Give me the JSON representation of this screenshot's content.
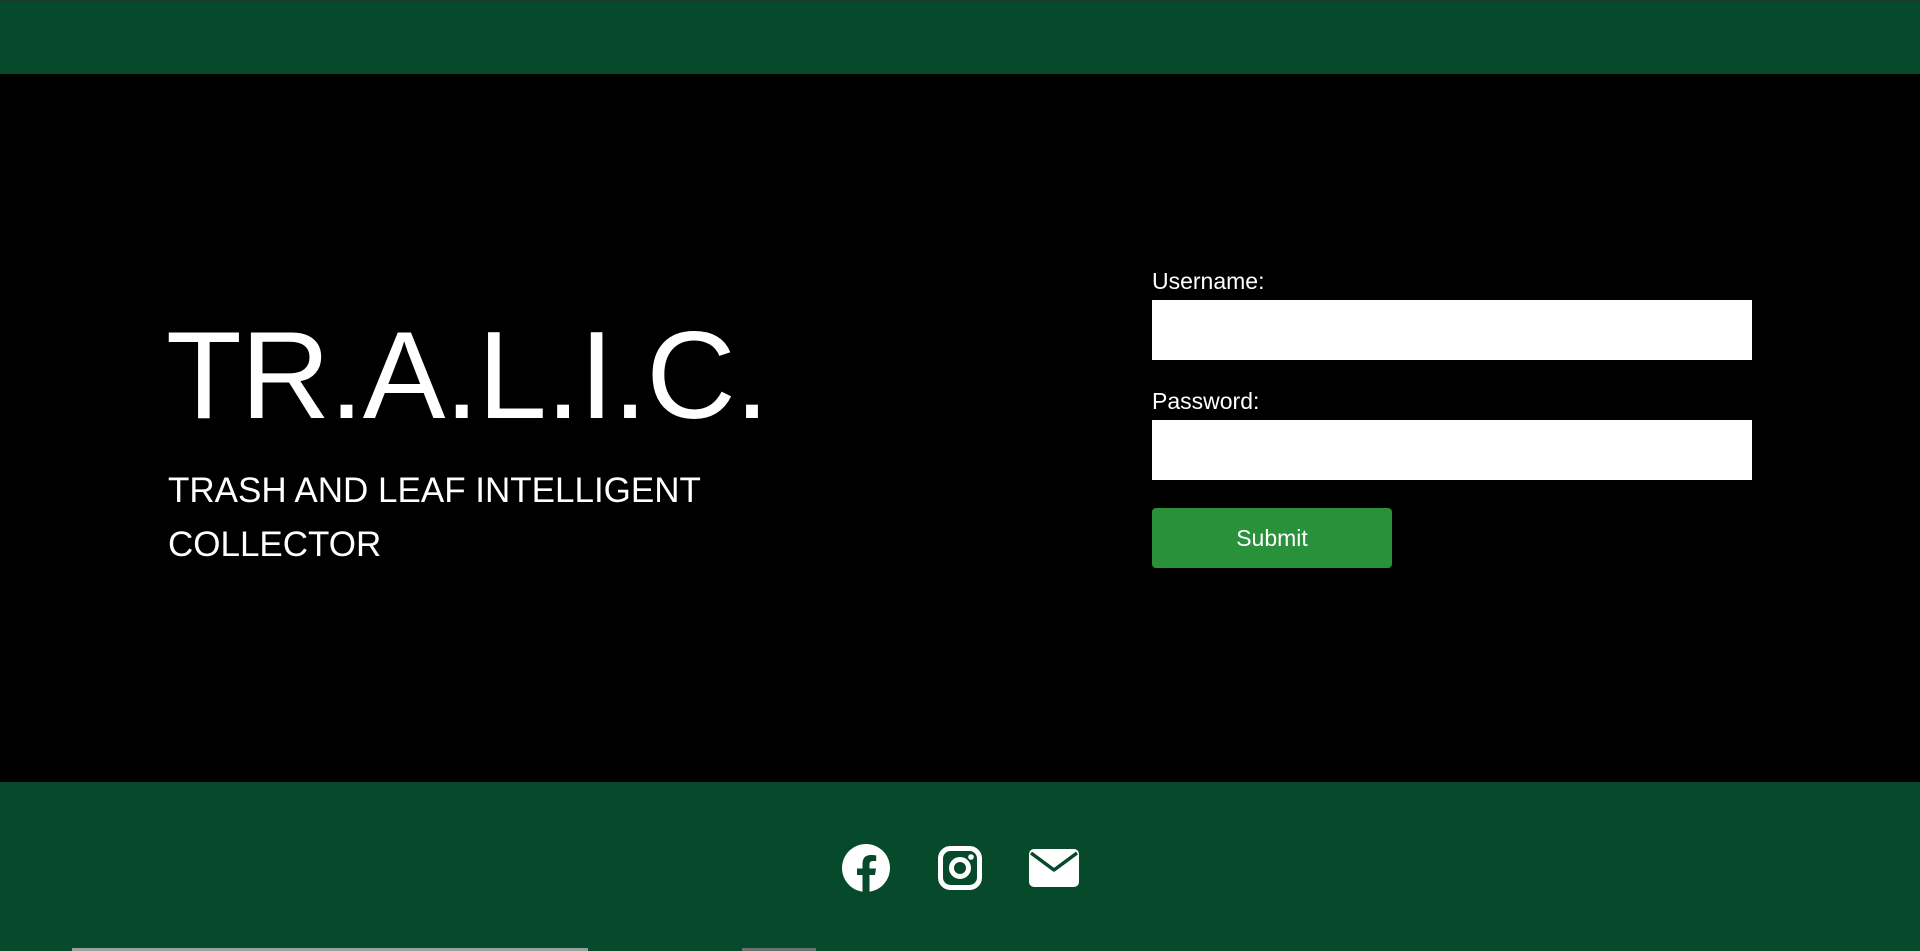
{
  "brand": {
    "title": "TR.A.L.I.C.",
    "subtitle": "TRASH AND LEAF INTELLIGENT COLLECTOR"
  },
  "login": {
    "username_label": "Username:",
    "username_value": "",
    "password_label": "Password:",
    "password_value": "",
    "submit_label": "Submit"
  },
  "footer": {
    "icons": [
      "facebook-icon",
      "instagram-icon",
      "mail-icon"
    ]
  },
  "colors": {
    "header_footer_bg": "#064a2b",
    "main_bg": "#000000",
    "submit_button": "#28913a",
    "text": "#ffffff"
  }
}
